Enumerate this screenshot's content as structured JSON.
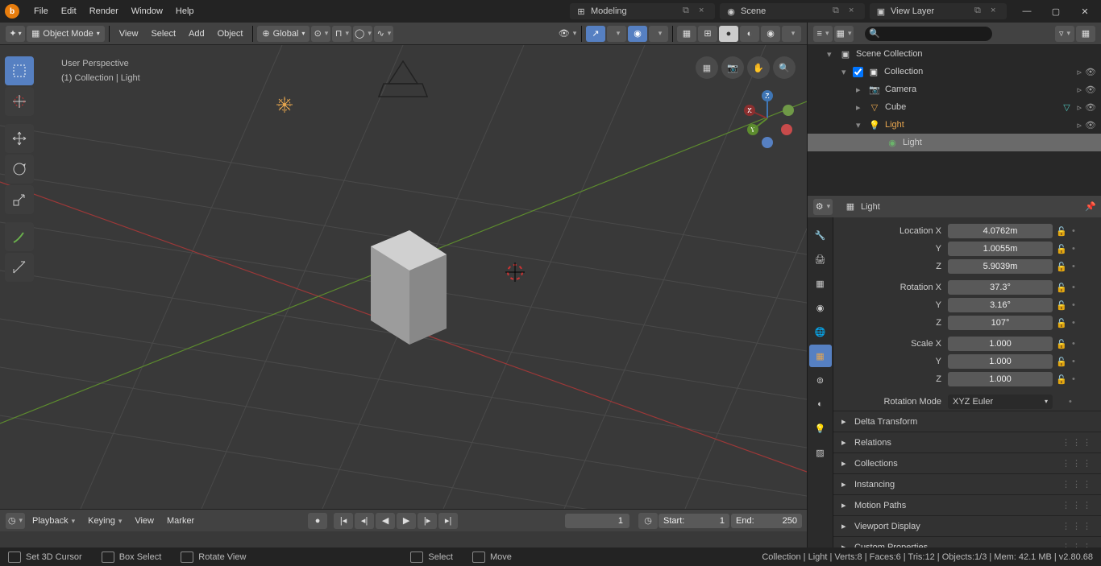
{
  "topmenu": {
    "file": "File",
    "edit": "Edit",
    "render": "Render",
    "window": "Window",
    "help": "Help"
  },
  "workspaces": {
    "active": "Modeling"
  },
  "scene": {
    "label": "Scene"
  },
  "viewlayer": {
    "label": "View Layer"
  },
  "toolbar": {
    "mode": "Object Mode",
    "view": "View",
    "select": "Select",
    "add": "Add",
    "object": "Object",
    "orientation": "Global"
  },
  "overlay": {
    "persp": "User Perspective",
    "context": "(1) Collection | Light"
  },
  "outliner": {
    "root": "Scene Collection",
    "collection": "Collection",
    "camera": "Camera",
    "cube": "Cube",
    "light": "Light",
    "lightdata": "Light"
  },
  "search": {
    "placeholder": ""
  },
  "props": {
    "breadcrumb": "Light",
    "location": {
      "label": "Location X",
      "y": "Y",
      "z": "Z",
      "vx": "4.0762m",
      "vy": "1.0055m",
      "vz": "5.9039m"
    },
    "rotation": {
      "label": "Rotation X",
      "y": "Y",
      "z": "Z",
      "vx": "37.3°",
      "vy": "3.16°",
      "vz": "107°"
    },
    "scale": {
      "label": "Scale X",
      "y": "Y",
      "z": "Z",
      "vx": "1.000",
      "vy": "1.000",
      "vz": "1.000"
    },
    "rotmode": {
      "label": "Rotation Mode",
      "value": "XYZ Euler"
    },
    "panels": {
      "delta": "Delta Transform",
      "relations": "Relations",
      "collections": "Collections",
      "instancing": "Instancing",
      "motion": "Motion Paths",
      "viewport": "Viewport Display",
      "custom": "Custom Properties"
    }
  },
  "timeline": {
    "playback": "Playback",
    "keying": "Keying",
    "view": "View",
    "marker": "Marker",
    "frame": "1",
    "start_label": "Start:",
    "start": "1",
    "end_label": "End:",
    "end": "250"
  },
  "status": {
    "cursor": "Set 3D Cursor",
    "box": "Box Select",
    "rotate": "Rotate View",
    "select": "Select",
    "move": "Move",
    "info": "Collection | Light | Verts:8 | Faces:6 | Tris:12 | Objects:1/3 | Mem: 42.1 MB | v2.80.68"
  }
}
